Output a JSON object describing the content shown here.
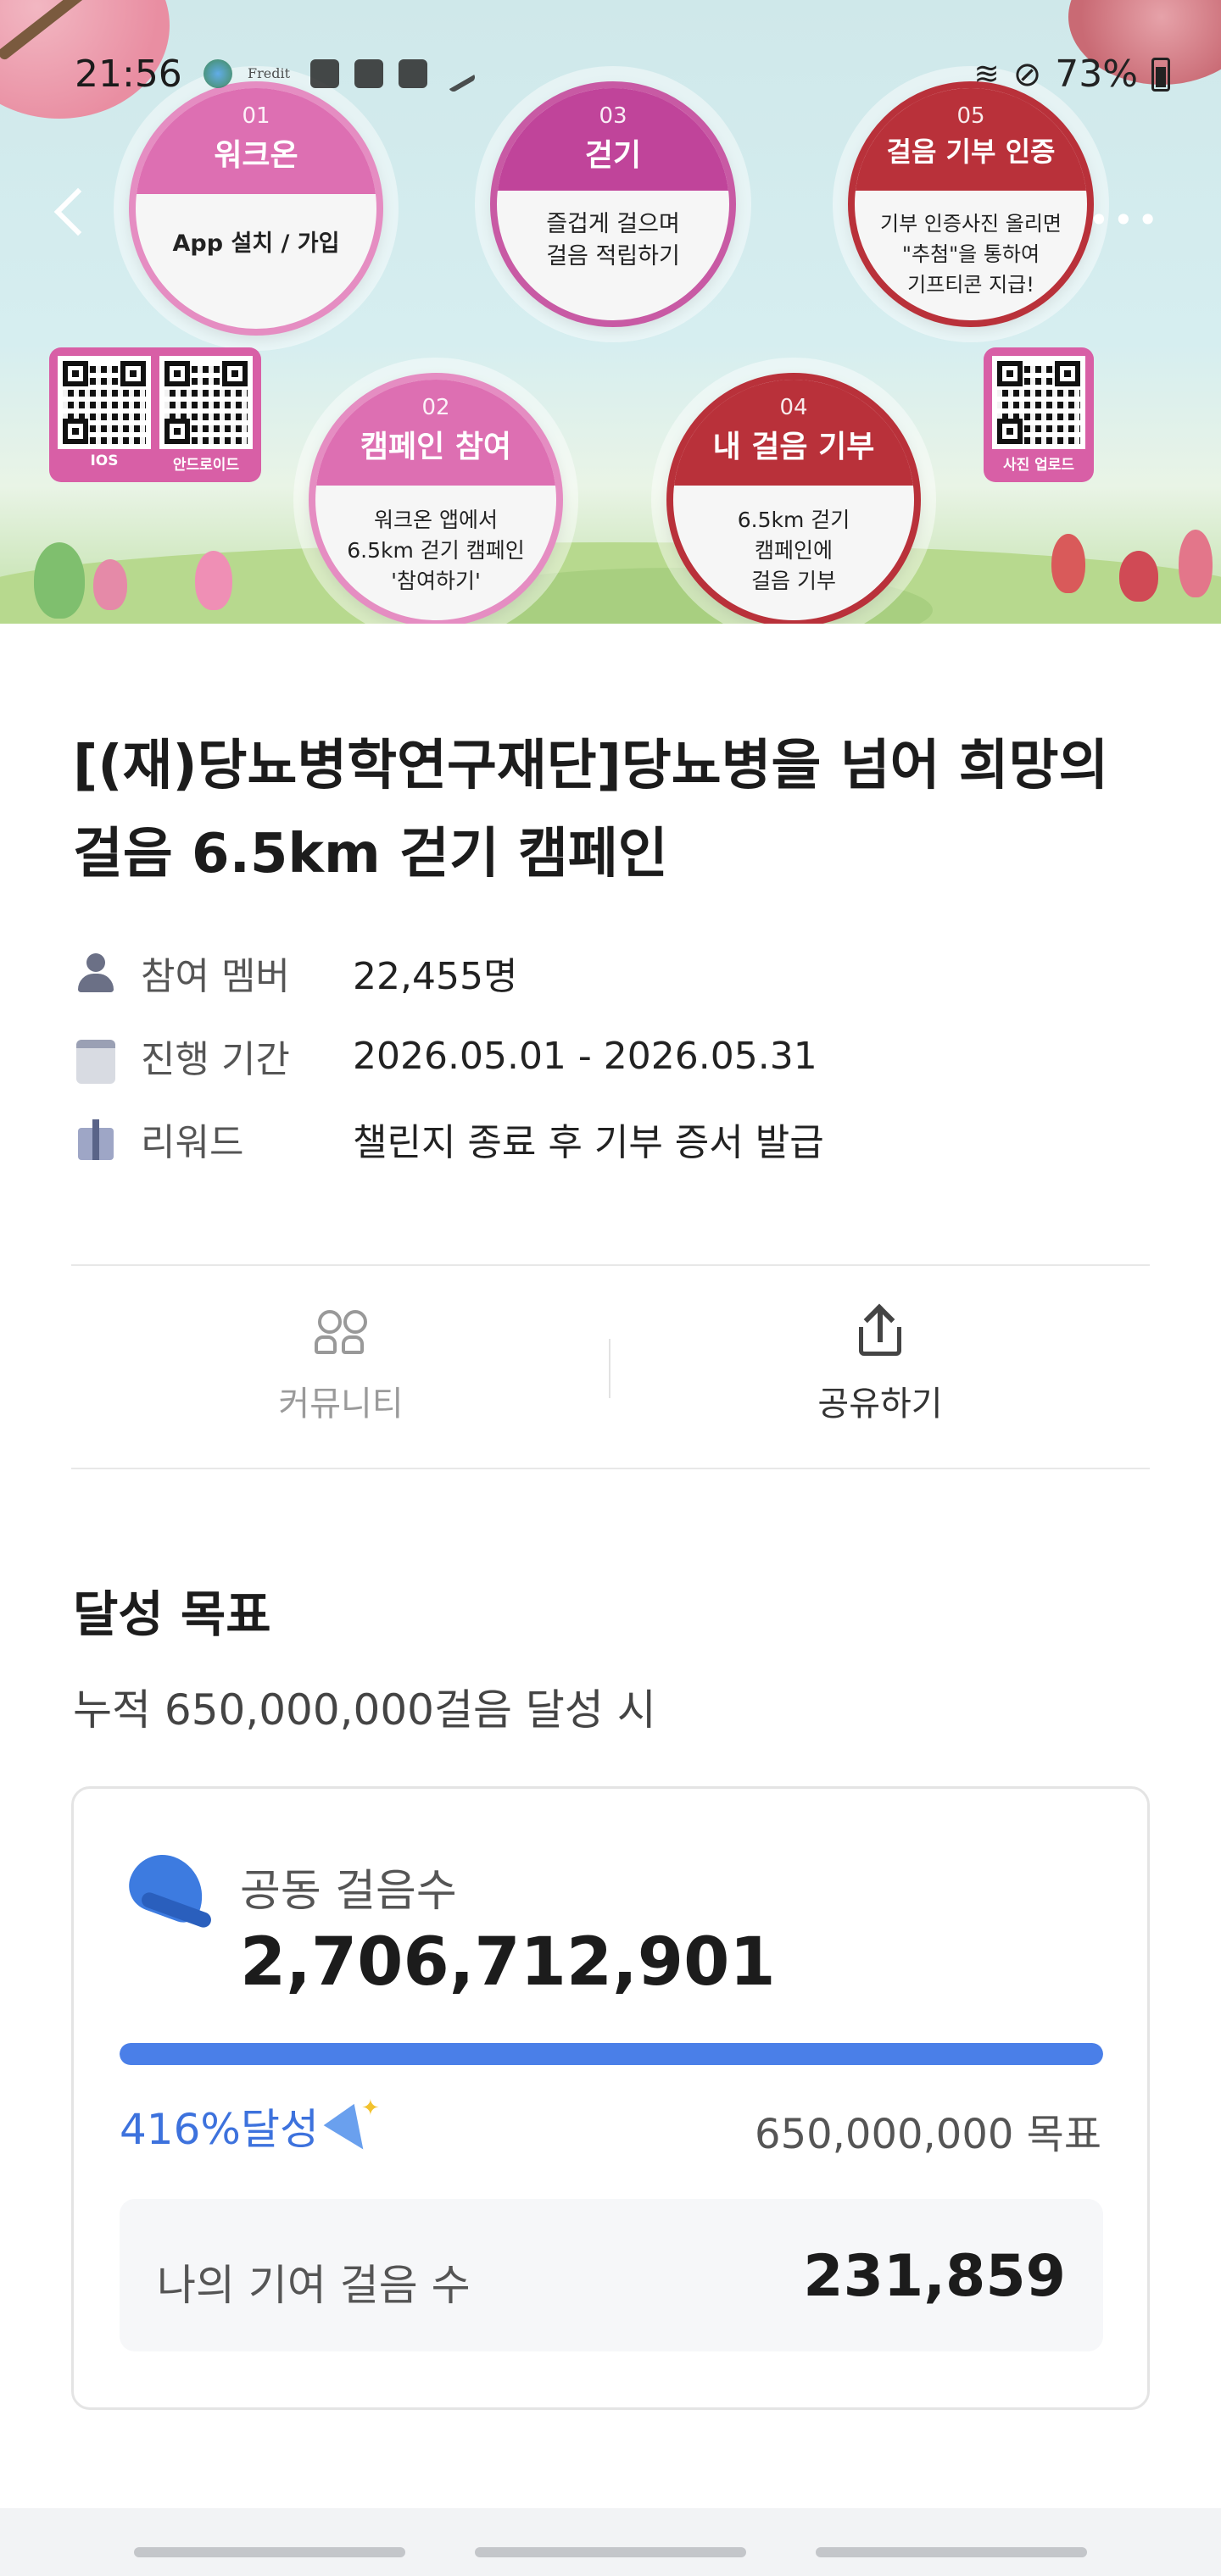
{
  "status_bar": {
    "time": "21:56",
    "battery": "73%",
    "fredit": "Fredit"
  },
  "banner": {
    "steps": [
      {
        "num": "01",
        "title": "워크온",
        "desc": "App 설치 / 가입"
      },
      {
        "num": "02",
        "title": "캠페인 참여",
        "desc": "워크온 앱에서\n6.5km 걷기 캠페인\n'참여하기'"
      },
      {
        "num": "03",
        "title": "걷기",
        "desc": "즐겁게 걸으며\n걸음 적립하기"
      },
      {
        "num": "04",
        "title": "내 걸음 기부",
        "desc": "6.5km 걷기\n캠페인에\n걸음 기부"
      },
      {
        "num": "05",
        "title": "걸음 기부 인증",
        "desc": "기부 인증사진 올리면\n\"추첨\"을 통하여\n기프티콘 지급!"
      }
    ],
    "qr_labels": {
      "ios": "IOS",
      "android": "안드로이드",
      "photo": "사진 업로드"
    }
  },
  "campaign": {
    "title": "[(재)당뇨병학연구재단]당뇨병을 넘어 희망의 걸음 6.5km 걷기 캠페인",
    "members_label": "참여 멤버",
    "members_value": "22,455명",
    "period_label": "진행 기간",
    "period_value": "2026.05.01 - 2026.05.31",
    "reward_label": "리워드",
    "reward_value": "챌린지 종료 후 기부 증서 발급"
  },
  "actions": {
    "community": "커뮤니티",
    "share": "공유하기"
  },
  "goal": {
    "title": "달성 목표",
    "subtitle": "누적 650,000,000걸음 달성 시",
    "total_label": "공동 걸음수",
    "total_value": "2,706,712,901",
    "progress_fraction": 1.0,
    "achieved_text": "416%달성",
    "goal_text": "650,000,000 목표",
    "my_label": "나의 기여 걸음 수",
    "my_value": "231,859"
  },
  "colors": {
    "accent": "#4a7fe8",
    "pink": "#dd6fb2",
    "magenta": "#c0449a",
    "red": "#b9313a"
  }
}
